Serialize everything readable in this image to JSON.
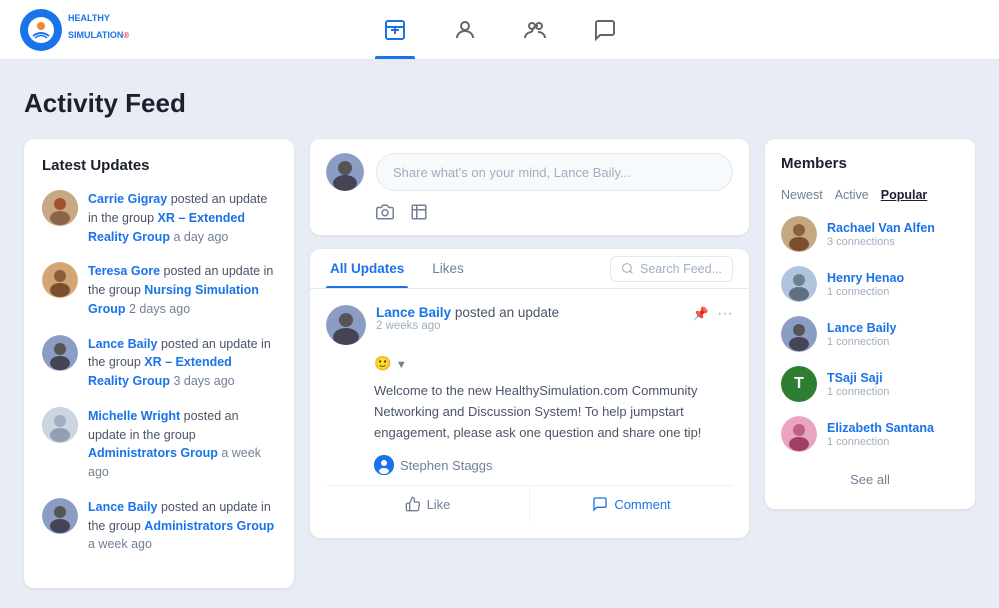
{
  "header": {
    "logo_text": "HEALTHY\nSIMULATION",
    "logo_emoji": "🌐",
    "nav_items": [
      {
        "name": "upload-icon",
        "label": "Upload",
        "active": true
      },
      {
        "name": "profile-icon",
        "label": "Profile",
        "active": false
      },
      {
        "name": "group-icon",
        "label": "Group",
        "active": false
      },
      {
        "name": "chat-icon",
        "label": "Chat",
        "active": false
      }
    ]
  },
  "page": {
    "title": "Activity Feed"
  },
  "latest_updates": {
    "section_title": "Latest Updates",
    "items": [
      {
        "author": "Carrie Gigray",
        "text": " posted an update in the group ",
        "link": "XR – Extended Reality Group",
        "time": " a day ago"
      },
      {
        "author": "Teresa Gore",
        "text": " posted an update in the group ",
        "link": "Nursing Simulation Group",
        "time": " 2 days ago"
      },
      {
        "author": "Lance Baily",
        "text": " posted an update in the group ",
        "link": "XR – Extended Reality Group",
        "time": " 3 days ago"
      },
      {
        "author": "Michelle Wright",
        "text": " posted an update in the group ",
        "link": "Administrators Group",
        "time": " a week ago"
      },
      {
        "author": "Lance Baily",
        "text": " posted an update in the group ",
        "link": "Administrators Group",
        "time": " a week ago"
      }
    ]
  },
  "post_box": {
    "placeholder": "Share what's on your mind, Lance Baily...",
    "camera_label": "Photo",
    "chart_label": "Chart"
  },
  "feed": {
    "tabs": [
      "All Updates",
      "Likes"
    ],
    "active_tab": "All Updates",
    "search_placeholder": "Search Feed...",
    "posts": [
      {
        "author": "Lance Baily",
        "action": "posted an update",
        "time": "2 weeks ago",
        "body": "Welcome to the new HealthySimulation.com Community Networking and Discussion System! To help jumpstart engagement, please ask one question and share one tip!",
        "reactor": "Stephen Staggs",
        "like_label": "Like",
        "comment_label": "Comment"
      }
    ]
  },
  "members": {
    "section_title": "Members",
    "tabs": [
      "Newest",
      "Active",
      "Popular"
    ],
    "active_tab": "Popular",
    "items": [
      {
        "name": "Rachael Van Alfen",
        "connections": "3 connections"
      },
      {
        "name": "Henry Henao",
        "connections": "1 connection"
      },
      {
        "name": "Lance Baily",
        "connections": "1 connection"
      },
      {
        "name": "TSaji Saji",
        "connections": "1 connection",
        "initial": "T"
      },
      {
        "name": "Elizabeth Santana",
        "connections": "1 connection"
      }
    ],
    "see_all_label": "See all"
  }
}
